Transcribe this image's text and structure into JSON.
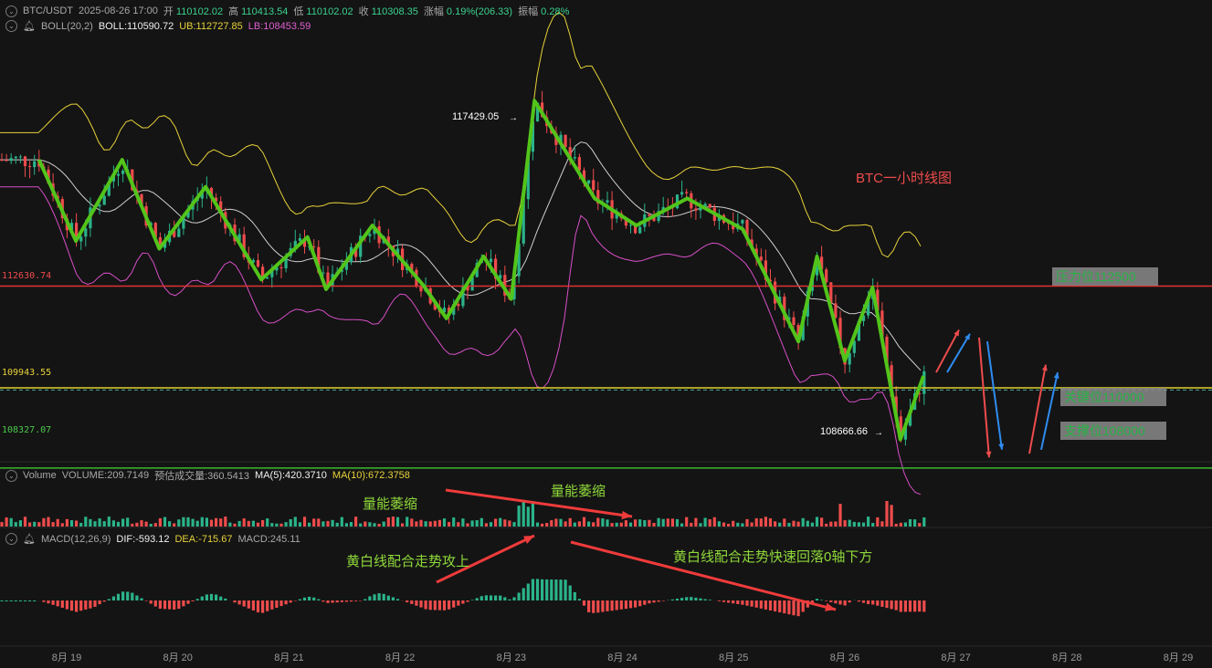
{
  "header": {
    "symbol": "BTC/USDT",
    "datetime": "2025-08-26 17:00",
    "open_label": "开",
    "open": "110102.02",
    "high_label": "高",
    "high": "110413.54",
    "low_label": "低",
    "low": "110102.02",
    "close_label": "收",
    "close": "110308.35",
    "change_label": "涨幅",
    "change": "0.19%(206.33)",
    "amp_label": "振幅",
    "amp": "0.28%"
  },
  "boll": {
    "label": "BOLL(20,2)",
    "boll": "BOLL:110590.72",
    "ub": "UB:112727.85",
    "lb": "LB:108453.59"
  },
  "volume": {
    "label": "Volume",
    "volume": "VOLUME:209.7149",
    "est": "预估成交量:360.5413",
    "ma5": "MA(5):420.3710",
    "ma10": "MA(10):672.3758"
  },
  "macd": {
    "label": "MACD(12,26,9)",
    "dif": "DIF:-593.12",
    "dea": "DEA:-715.67",
    "macd": "MACD:245.11"
  },
  "annotations": {
    "title": "BTC一小时线图",
    "high_label": "117429.05",
    "low_label": "108666.66",
    "resistance": "压力位112500",
    "key": "关键位110000",
    "support": "支撑位108000",
    "vol_shrink_1": "量能萎缩",
    "vol_shrink_2": "量能萎缩",
    "macd_up": "黄白线配合走势攻上",
    "macd_down": "黄白线配合走势快速回落0轴下方"
  },
  "price_labels": {
    "red": "112630.74",
    "dashed": "109943.55",
    "green": "108327.07"
  },
  "colors": {
    "up": "#2bb38a",
    "down": "#ef4c4c",
    "boll_upper": "#e8d23a",
    "boll_mid": "#cfcfcf",
    "boll_lower": "#d84fc8",
    "trend": "#52c41a"
  },
  "chart_data": {
    "type": "candlestick",
    "x_ticks": [
      "8月 19",
      "8月 20",
      "8月 21",
      "8月 22",
      "8月 23",
      "8月 24",
      "8月 25",
      "8月 26",
      "8月 27",
      "8月 28",
      "8月 29"
    ],
    "levels": {
      "resistance": 112500,
      "key": 110000,
      "support": 108000,
      "red_line": 112630.74,
      "dashed_line": 109943.55,
      "green_line": 108327.07
    },
    "swing_high": 117429.05,
    "swing_low": 108666.66,
    "trend_path": [
      [
        "8月 18 18:00",
        115900
      ],
      [
        "8月 19 02:00",
        113800
      ],
      [
        "8月 19 12:00",
        115900
      ],
      [
        "8月 19 20:00",
        113600
      ],
      [
        "8月 20 06:00",
        115200
      ],
      [
        "8月 20 18:00",
        112800
      ],
      [
        "8月 21 04:00",
        113900
      ],
      [
        "8月 21 08:00",
        112550
      ],
      [
        "8月 21 18:00",
        114200
      ],
      [
        "8月 22 05:00",
        112650
      ],
      [
        "8月 22 10:00",
        111800
      ],
      [
        "8月 22 18:00",
        113400
      ],
      [
        "8月 23 00:00",
        112300
      ],
      [
        "8月 23 05:00",
        117429
      ],
      [
        "8月 23 18:00",
        114900
      ],
      [
        "8月 24 03:00",
        114200
      ],
      [
        "8月 24 14:00",
        114900
      ],
      [
        "8月 25 02:00",
        114100
      ],
      [
        "8月 25 14:00",
        111200
      ],
      [
        "8月 25 18:00",
        113400
      ],
      [
        "8月 26 00:00",
        110700
      ],
      [
        "8月 26 06:00",
        112600
      ],
      [
        "8月 26 12:00",
        108666.66
      ],
      [
        "8月 26 17:00",
        110308
      ]
    ],
    "projection": [
      {
        "from": 110400,
        "to": 111500,
        "color": "red"
      },
      {
        "from": 110400,
        "to": 111400,
        "color": "blue"
      },
      {
        "from": 111300,
        "to": 108200,
        "color": "red"
      },
      {
        "from": 111200,
        "to": 108400,
        "color": "blue"
      },
      {
        "from": 108300,
        "to": 110600,
        "color": "red"
      },
      {
        "from": 108400,
        "to": 110400,
        "color": "blue"
      }
    ]
  }
}
